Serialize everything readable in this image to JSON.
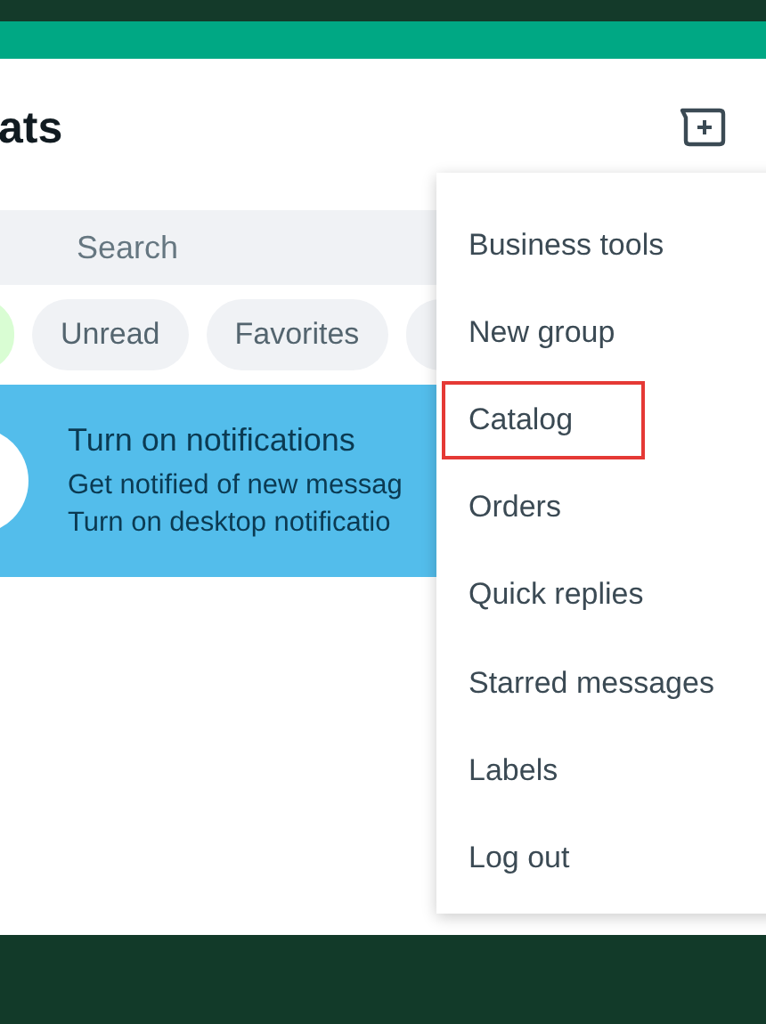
{
  "header": {
    "title": "ats"
  },
  "search": {
    "placeholder": "Search"
  },
  "filters": [
    {
      "selected": true
    },
    {
      "label": "Unread",
      "selected": false
    },
    {
      "label": "Favorites",
      "selected": false
    },
    {
      "selected": false
    }
  ],
  "banner": {
    "title": "Turn on notifications",
    "lines": [
      "Get notified of new messag",
      "Turn on desktop notificatio"
    ]
  },
  "menu": [
    {
      "label": "Business tools",
      "highlighted": false
    },
    {
      "label": "New group",
      "highlighted": false
    },
    {
      "label": "Catalog",
      "highlighted": true
    },
    {
      "label": "Orders",
      "highlighted": false
    },
    {
      "label": "Quick replies",
      "highlighted": false
    },
    {
      "label": "Starred messages",
      "highlighted": false
    },
    {
      "label": "Labels",
      "highlighted": false
    },
    {
      "label": "Log out",
      "highlighted": false
    }
  ]
}
